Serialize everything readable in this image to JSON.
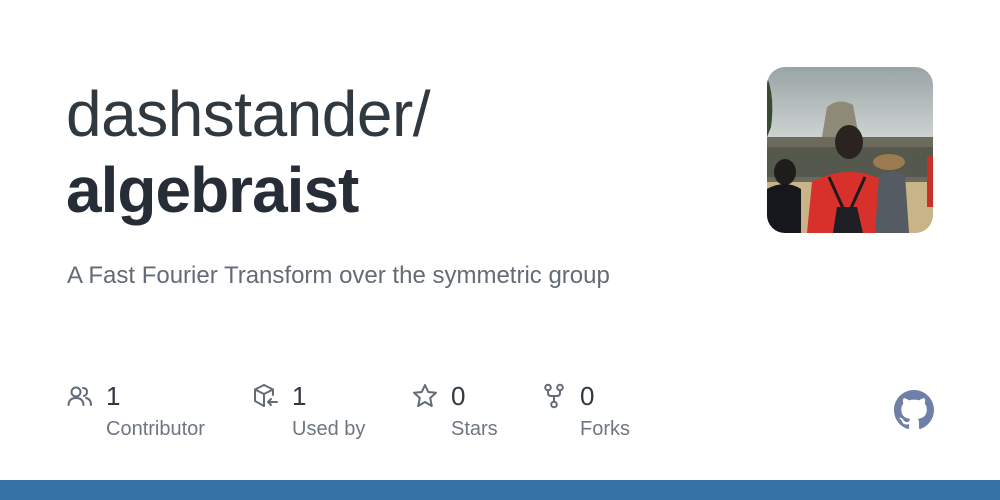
{
  "repo": {
    "owner": "dashstander/",
    "name": "algebraist",
    "description": "A Fast Fourier Transform over the symmetric group"
  },
  "stats": [
    {
      "icon": "people-icon",
      "value": "1",
      "label": "Contributor"
    },
    {
      "icon": "package-dependents-icon",
      "value": "1",
      "label": "Used by"
    },
    {
      "icon": "star-icon",
      "value": "0",
      "label": "Stars"
    },
    {
      "icon": "repo-forked-icon",
      "value": "0",
      "label": "Forks"
    }
  ],
  "colors": {
    "language_bar": "#3572a5",
    "github_logo": "#6e7fa8"
  }
}
